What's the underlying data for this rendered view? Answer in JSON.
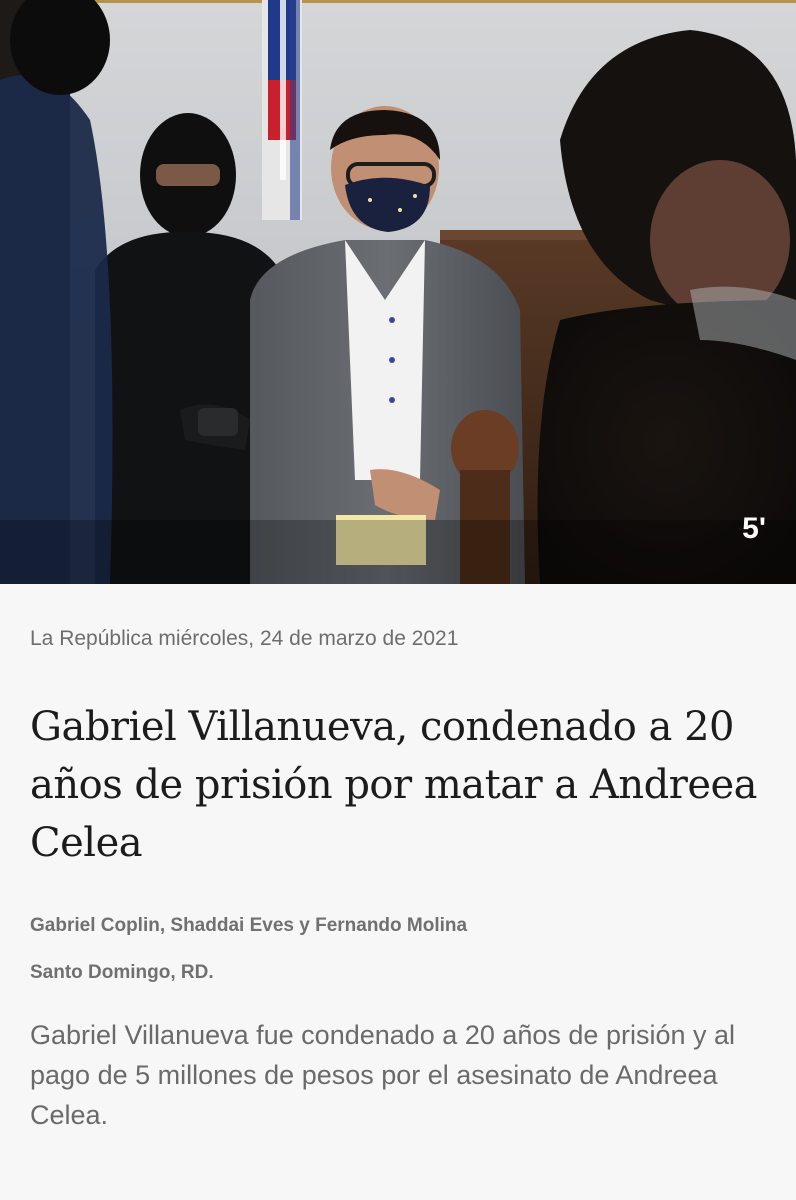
{
  "hero": {
    "image_alt": "Gabriel Villanueva escoltado en la sala de audiencias",
    "read_time": "5'",
    "read_time_icon": "stopwatch-icon"
  },
  "article": {
    "source_line": "La República miércoles, 24 de marzo de 2021",
    "headline": "Gabriel Villanueva, condenado a 20 años de prisión por matar a Andreea Celea",
    "byline": "Gabriel Coplin, Shaddai Eves y Fernando Molina",
    "dateline": "Santo Domingo, RD.",
    "lead": "Gabriel Villanueva fue condenado a 20 años de prisión y al pago de 5 millones de pesos por el asesinato de Andreea Celea."
  },
  "colors": {
    "background": "#f7f7f7",
    "headline": "#1c1c1c",
    "meta_text": "#707070",
    "body_text": "#6a6a6a"
  }
}
